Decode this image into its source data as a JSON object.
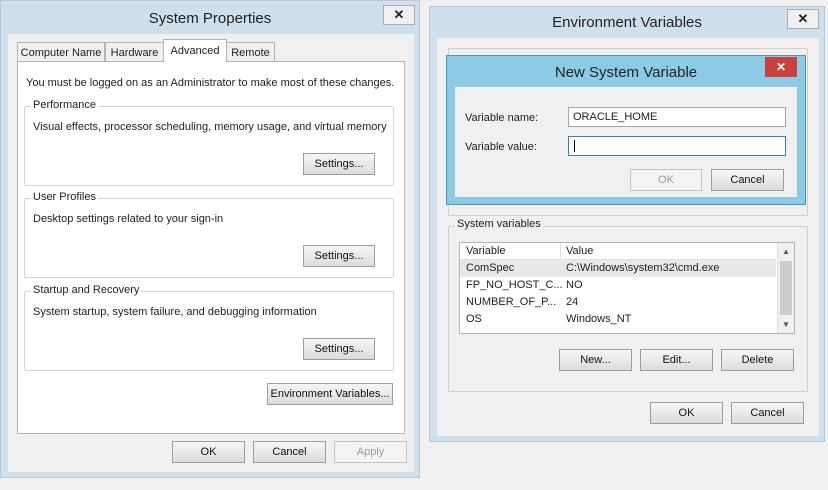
{
  "system_properties": {
    "title": "System Properties",
    "close_glyph": "✕",
    "tabs": [
      {
        "label": "Computer Name"
      },
      {
        "label": "Hardware"
      },
      {
        "label": "Advanced"
      },
      {
        "label": "Remote"
      }
    ],
    "admin_notice": "You must be logged on as an Administrator to make most of these changes.",
    "performance": {
      "title": "Performance",
      "description": "Visual effects, processor scheduling, memory usage, and virtual memory",
      "button": "Settings..."
    },
    "user_profiles": {
      "title": "User Profiles",
      "description": "Desktop settings related to your sign-in",
      "button": "Settings..."
    },
    "startup_recovery": {
      "title": "Startup and Recovery",
      "description": "System startup, system failure, and debugging information",
      "button": "Settings..."
    },
    "env_button": "Environment Variables...",
    "ok": "OK",
    "cancel": "Cancel",
    "apply": "Apply"
  },
  "environment_variables": {
    "title": "Environment Variables",
    "close_glyph": "✕",
    "system_variables_label": "System variables",
    "columns": [
      "Variable",
      "Value"
    ],
    "rows": [
      {
        "variable": "ComSpec",
        "value": "C:\\Windows\\system32\\cmd.exe"
      },
      {
        "variable": "FP_NO_HOST_C...",
        "value": "NO"
      },
      {
        "variable": "NUMBER_OF_P...",
        "value": "24"
      },
      {
        "variable": "OS",
        "value": "Windows_NT"
      }
    ],
    "new_button": "New...",
    "edit_button": "Edit...",
    "delete_button": "Delete",
    "ok": "OK",
    "cancel": "Cancel"
  },
  "new_system_variable": {
    "title": "New System Variable",
    "close_glyph": "✕",
    "name_label": "Variable name:",
    "name_value": "ORACLE_HOME",
    "value_label": "Variable value:",
    "value_value": "",
    "ok": "OK",
    "cancel": "Cancel"
  },
  "colors": {
    "dialog_frame": "#8ccbe6",
    "close_red": "#c9423a",
    "selected_row": "#e8e8e8"
  }
}
